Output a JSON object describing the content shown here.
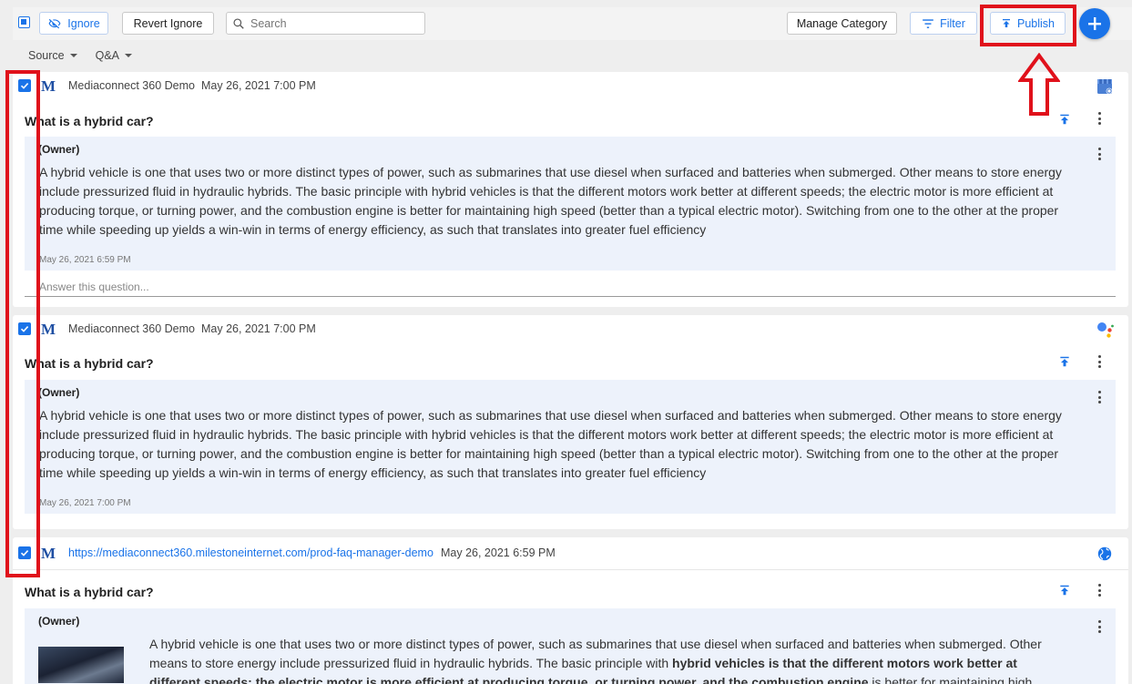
{
  "toolbar": {
    "ignore_label": "Ignore",
    "revert_ignore_label": "Revert Ignore",
    "search_placeholder": "Search",
    "manage_category_label": "Manage Category",
    "filter_label": "Filter",
    "publish_label": "Publish"
  },
  "filters": {
    "source_label": "Source",
    "qa_label": "Q&A"
  },
  "colors": {
    "accent": "#1a73e8",
    "highlight": "#e0111b",
    "answer_bg": "#edf2fb"
  },
  "cards": [
    {
      "source": "Mediaconnect 360 Demo",
      "date": "May 26, 2021 7:00 PM",
      "platform_icon": "google-my-business-icon",
      "question": "What is a hybrid car?",
      "owner": "(Owner)",
      "answer": "A hybrid vehicle is one that uses two or more distinct types of power, such as submarines that use diesel when surfaced and batteries when submerged. Other means to store energy include pressurized fluid in hydraulic hybrids. The basic principle with hybrid vehicles is that the different motors work better at different speeds; the electric motor is more efficient at producing torque, or turning power, and the combustion engine is better for maintaining high speed (better than a typical electric motor). Switching from one to the other at the proper time while speeding up yields a win-win in terms of energy efficiency, as such that translates into greater fuel efficiency",
      "answer_date": "May 26, 2021 6:59 PM",
      "answer_placeholder": "Answer this question..."
    },
    {
      "source": "Mediaconnect 360 Demo",
      "date": "May 26, 2021 7:00 PM",
      "platform_icon": "google-assistant-icon",
      "question": "What is a hybrid car?",
      "owner": "(Owner)",
      "answer": "A hybrid vehicle is one that uses two or more distinct types of power, such as submarines that use diesel when surfaced and batteries when submerged. Other means to store energy include pressurized fluid in hydraulic hybrids. The basic principle with hybrid vehicles is that the different motors work better at different speeds; the electric motor is more efficient at producing torque, or turning power, and the combustion engine is better for maintaining high speed (better than a typical electric motor). Switching from one to the other at the proper time while speeding up yields a win-win in terms of energy efficiency, as such that translates into greater fuel efficiency",
      "answer_date": "May 26, 2021 7:00 PM"
    },
    {
      "source": "https://mediaconnect360.milestoneinternet.com/prod-faq-manager-demo",
      "date": "May 26, 2021 6:59 PM",
      "platform_icon": "globe-icon",
      "question": "What is a hybrid car?",
      "owner": "(Owner)",
      "answer_part1": "A hybrid vehicle is one that uses two or more distinct types of power, such as submarines that use diesel when surfaced and batteries when submerged. Other means to store energy include pressurized fluid in hydraulic hybrids. The basic principle with ",
      "answer_bold": "hybrid vehicles is that the different motors work better at different speeds; the electric motor is more efficient at producing torque, or turning power, and the combustion engine",
      "answer_part2": " is better for maintaining high speed (better than a"
    }
  ]
}
